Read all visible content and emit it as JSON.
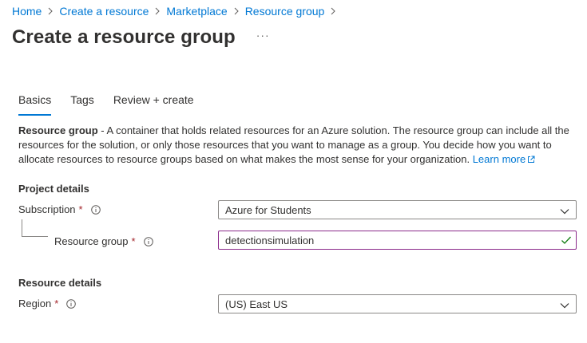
{
  "breadcrumb": [
    "Home",
    "Create a resource",
    "Marketplace",
    "Resource group"
  ],
  "title": "Create a resource group",
  "more_label": "···",
  "tabs": [
    "Basics",
    "Tags",
    "Review + create"
  ],
  "description": {
    "term": "Resource group",
    "text": " - A container that holds related resources for an Azure solution. The resource group can include all the resources for the solution, or only those resources that you want to manage as a group. You decide how you want to allocate resources to resource groups based on what makes the most sense for your organization. ",
    "link": "Learn more"
  },
  "project_details": {
    "heading": "Project details",
    "subscription_label": "Subscription",
    "subscription_value": "Azure for Students",
    "resource_group_label": "Resource group",
    "resource_group_value": "detectionsimulation"
  },
  "resource_details": {
    "heading": "Resource details",
    "region_label": "Region",
    "region_value": "(US) East US"
  },
  "required_mark": "*",
  "colors": {
    "link": "#0078d4",
    "required": "#a4262c",
    "valid_check": "#107c10",
    "active_border": "#8b2a8b"
  }
}
